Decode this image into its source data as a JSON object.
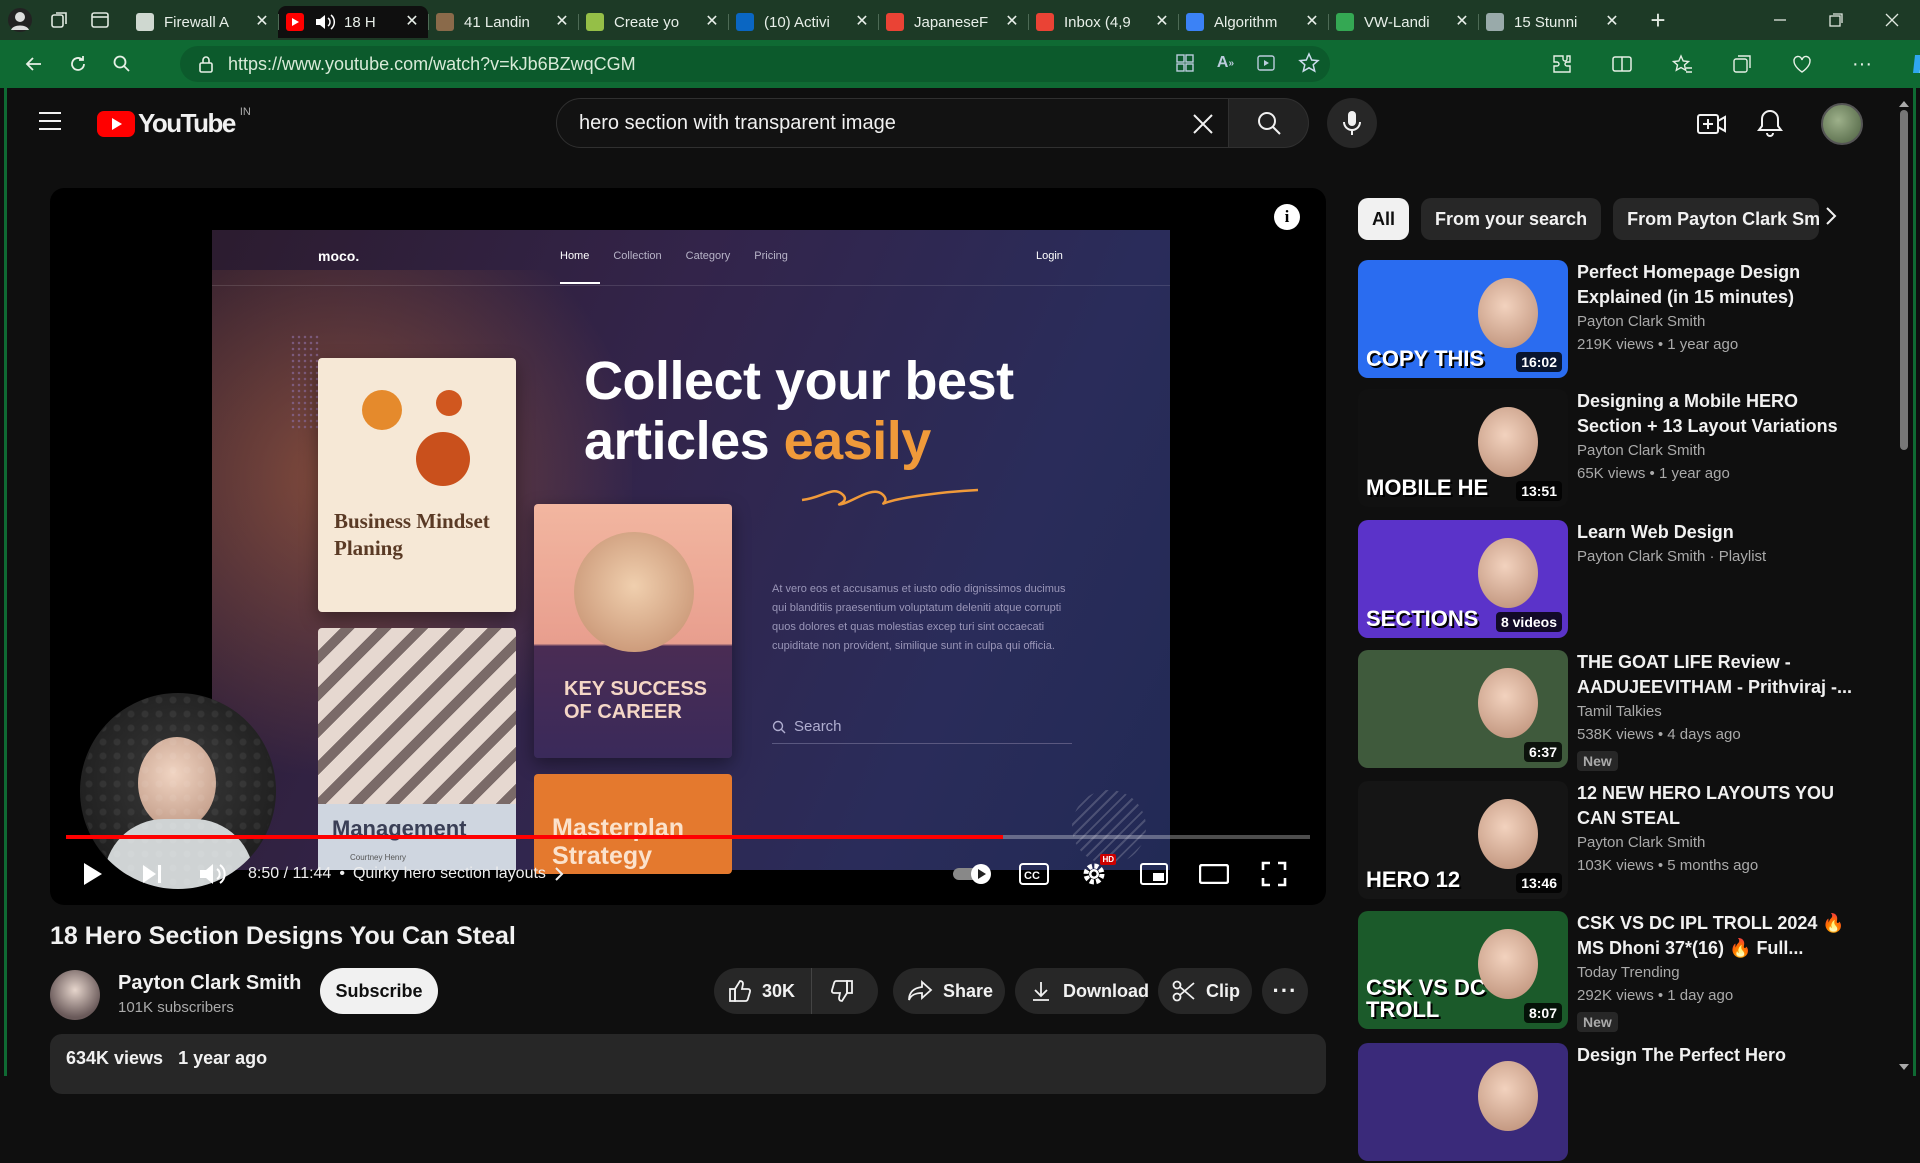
{
  "browser": {
    "tabs": [
      {
        "title": "Firewall A",
        "favicon": "doc-icon",
        "color": "#cfd8d0"
      },
      {
        "title": "18 H",
        "favicon": "youtube-icon",
        "color": "#ff0000",
        "active": true
      },
      {
        "title": "41 Landin",
        "favicon": "landing-icon",
        "color": "#8a6a4a"
      },
      {
        "title": "Create yo",
        "favicon": "shopify-icon",
        "color": "#95bf47"
      },
      {
        "title": "(10) Activi",
        "favicon": "linkedin-icon",
        "color": "#0a66c2"
      },
      {
        "title": "JapaneseF",
        "favicon": "gmail-icon",
        "color": "#ea4335"
      },
      {
        "title": "Inbox (4,9",
        "favicon": "gmail-icon",
        "color": "#ea4335"
      },
      {
        "title": "Algorithm",
        "favicon": "c-icon",
        "color": "#3b82f6"
      },
      {
        "title": "VW-Landi",
        "favicon": "drive-icon",
        "color": "#34a853"
      },
      {
        "title": "15 Stunni",
        "favicon": "web-icon",
        "color": "#9aa"
      }
    ],
    "url": "https://www.youtube.com/watch?v=kJb6BZwqCGM"
  },
  "youtube": {
    "logo_text": "YouTube",
    "region": "IN",
    "search_value": "hero section with transparent image"
  },
  "player": {
    "screen": {
      "brand": "moco.",
      "nav": [
        "Home",
        "Collection",
        "Category",
        "Pricing"
      ],
      "login": "Login",
      "hero_line1": "Collect your best",
      "hero_line2_a": "articles ",
      "hero_line2_b": "easily",
      "paragraph": "At vero eos et accusamus et iusto odio dignissimos ducimus qui blanditiis praesentium voluptatum deleniti atque corrupti quos dolores et quas molestias excep turi sint occaecati cupiditate non provident, similique sunt in culpa qui officia.",
      "search_label": "Search",
      "card1": "Business Mindset Planing",
      "card2": "KEY SUCCESS OF CAREER",
      "card3": "Management",
      "card3_sub": "Courtney Henry",
      "card4": "Masterplan Strategy"
    },
    "time": "8:50 / 11:44",
    "chapter": "Quirky hero section layouts",
    "progress": 0.7535,
    "hd_badge": "HD"
  },
  "video": {
    "title": "18 Hero Section Designs You Can Steal",
    "channel": "Payton Clark Smith",
    "subscribers": "101K subscribers",
    "subscribe": "Subscribe",
    "likes": "30K",
    "share": "Share",
    "download": "Download",
    "clip": "Clip",
    "views": "634K views",
    "age": "1 year ago"
  },
  "chips": [
    "All",
    "From your search",
    "From Payton Clark Smit"
  ],
  "recs": [
    {
      "title": "Perfect Homepage Design Explained (in 15 minutes)",
      "channel": "Payton Clark Smith",
      "meta": "219K views  •  1 year ago",
      "duration": "16:02",
      "thumb": "#2a6cf0",
      "thumb_text": "COPY THIS"
    },
    {
      "title": "Designing a Mobile HERO Section + 13 Layout Variations",
      "channel": "Payton Clark Smith",
      "meta": "65K views  •  1 year ago",
      "duration": "13:51",
      "thumb": "#111",
      "thumb_text": "MOBILE HE"
    },
    {
      "title": "Learn Web Design",
      "channel": "Payton Clark Smith · Playlist",
      "meta": "",
      "duration": "8 videos",
      "thumb": "#5b33c9",
      "thumb_text": "SECTIONS"
    },
    {
      "title": "THE GOAT LIFE Review - AADUJEEVITHAM - Prithviraj -...",
      "channel": "Tamil Talkies",
      "meta": "538K views  •  4 days ago",
      "duration": "6:37",
      "thumb": "#3f5a3c",
      "thumb_text": "",
      "badge": "New"
    },
    {
      "title": "12 NEW HERO LAYOUTS YOU CAN STEAL",
      "channel": "Payton Clark Smith",
      "meta": "103K views  •  5 months ago",
      "duration": "13:46",
      "thumb": "#151515",
      "thumb_text": "HERO 12"
    },
    {
      "title": "CSK VS DC IPL TROLL 2024 🔥 MS Dhoni 37*(16) 🔥 Full...",
      "channel": "Today Trending",
      "meta": "292K views  •  1 day ago",
      "duration": "8:07",
      "thumb": "#1b5a2a",
      "thumb_text": "CSK VS DC TROLL",
      "badge": "New"
    },
    {
      "title": "Design The Perfect Hero",
      "channel": "",
      "meta": "",
      "duration": "",
      "thumb": "#3a2a7a",
      "thumb_text": ""
    }
  ]
}
